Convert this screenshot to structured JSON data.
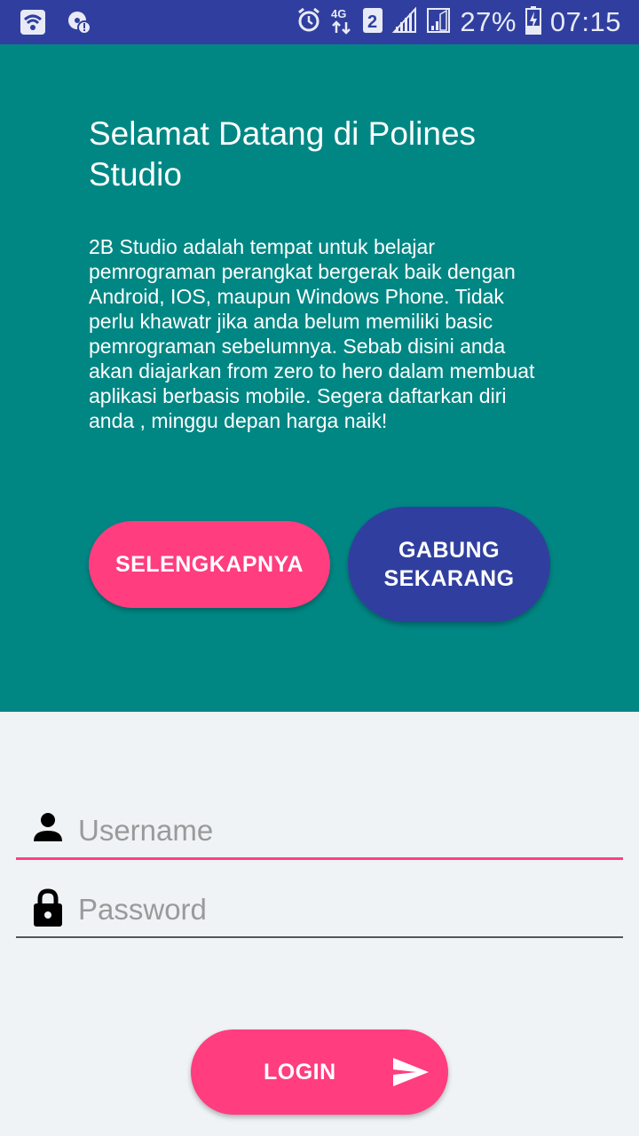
{
  "status_bar": {
    "battery": "27%",
    "time": "07:15",
    "network_type": "4G",
    "sim_slot": "2",
    "icons": [
      "wifi-icon",
      "data-saver-icon",
      "alarm-icon",
      "network-4g-icon",
      "sim-2-icon",
      "signal-icon",
      "signal-icon",
      "battery-charging-icon"
    ]
  },
  "hero": {
    "title": "Selamat Datang di Polines Studio",
    "description": "2B Studio adalah tempat untuk belajar pemrograman perangkat bergerak baik dengan Android, IOS, maupun Windows Phone. Tidak perlu khawatr jika anda belum memiliki basic pemrograman sebelumnya. Sebab disini anda akan diajarkan from zero to hero dalam membuat aplikasi berbasis mobile. Segera daftarkan diri anda , minggu depan harga naik!",
    "more_button": "SELENGKAPNYA",
    "join_button": "GABUNG\nSEKARANG",
    "background": "#008784"
  },
  "form": {
    "username_placeholder": "Username",
    "username_value": "",
    "password_placeholder": "Password",
    "password_value": "",
    "login_button": "LOGIN",
    "login_icon": "send-icon"
  },
  "colors": {
    "accent": "#ff3d7f",
    "primary": "#303f9f",
    "hero": "#008784"
  }
}
